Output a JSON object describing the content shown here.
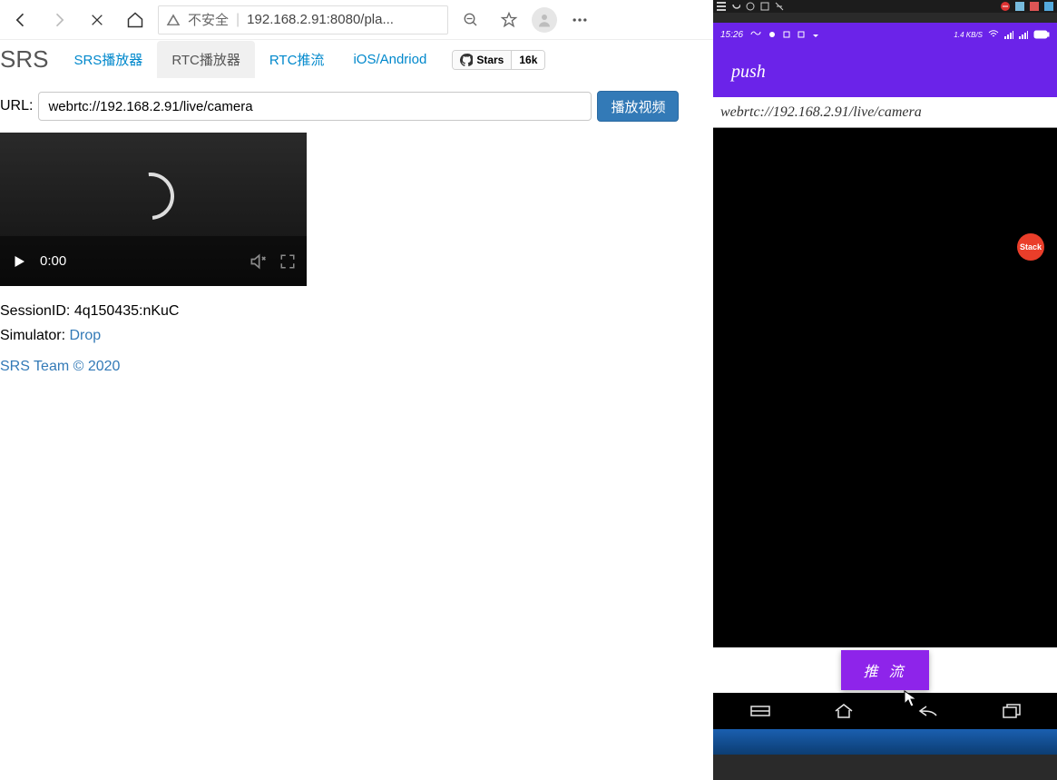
{
  "browser": {
    "security_label": "不安全",
    "url_text": "192.168.2.91:8080/pla..."
  },
  "page": {
    "brand": "SRS",
    "tabs": [
      "SRS播放器",
      "RTC播放器",
      "RTC推流",
      "iOS/Andriod"
    ],
    "active_tab_index": 1,
    "github": {
      "stars_label": "Stars",
      "count": "16k"
    },
    "url_label": "URL:",
    "url_value": "webrtc://192.168.2.91/live/camera",
    "play_button": "播放视频",
    "video_time": "0:00",
    "session_label": "SessionID:",
    "session_id": "4q150435:nKuC",
    "simulator_label": "Simulator:",
    "simulator_link": "Drop",
    "footer": "SRS Team © 2020"
  },
  "phone": {
    "status_time": "15:26",
    "status_speed": "1.4 KB/S",
    "title": "push",
    "url": "webrtc://192.168.2.91/live/camera",
    "stack_label": "Stack",
    "push_button": "推 流"
  }
}
